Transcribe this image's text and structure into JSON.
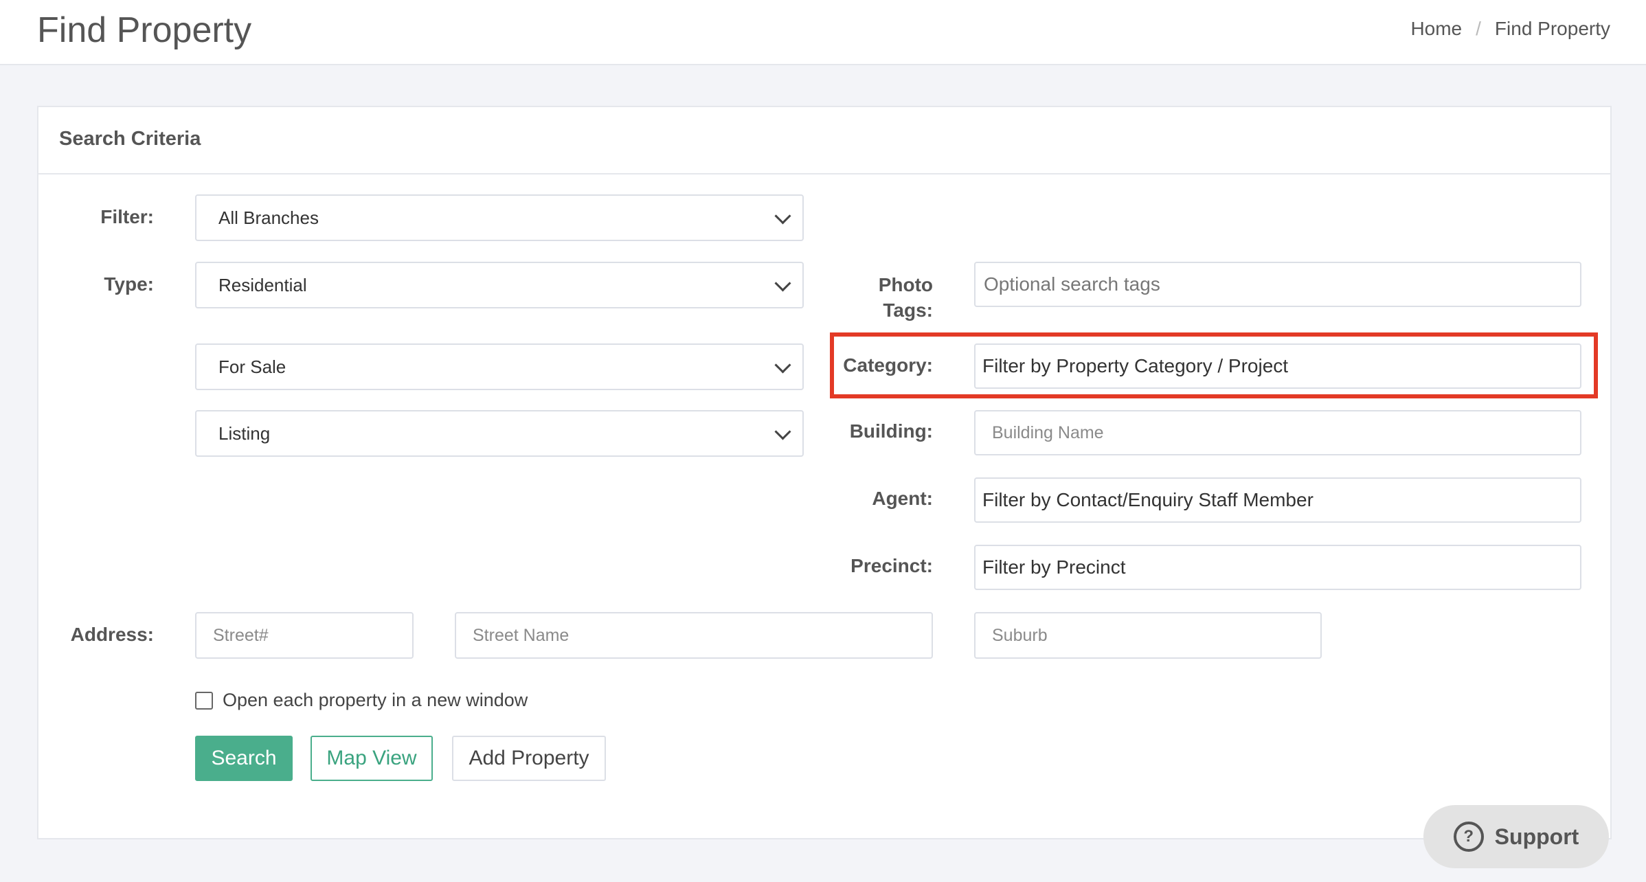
{
  "header": {
    "title": "Find Property",
    "breadcrumb": [
      "Home",
      "Find Property"
    ],
    "breadcrumb_separator": "/"
  },
  "card": {
    "title": "Search Criteria"
  },
  "labels": {
    "filter": "Filter:",
    "type": "Type:",
    "photo_tags_line1": "Photo",
    "photo_tags_line2": "Tags:",
    "category": "Category:",
    "building": "Building:",
    "agent": "Agent:",
    "precinct": "Precinct:",
    "address": "Address:"
  },
  "selects": {
    "filter": "All Branches",
    "type": "Residential",
    "sale_type": "For Sale",
    "status": "Listing"
  },
  "inputs": {
    "photo_tags_placeholder": "Optional search tags",
    "category_value": "Filter by Property Category / Project",
    "building_placeholder": "Building Name",
    "agent_value": "Filter by Contact/Enquiry Staff Member",
    "precinct_value": "Filter by Precinct",
    "street_no_placeholder": "Street#",
    "street_name_placeholder": "Street Name",
    "suburb_placeholder": "Suburb"
  },
  "options": {
    "new_window_label": "Open each property in a new window"
  },
  "buttons": {
    "search": "Search",
    "map_view": "Map View",
    "add_property": "Add Property"
  },
  "support": {
    "label": "Support",
    "icon": "question-circle-icon"
  },
  "colors": {
    "accent": "#4aae8c",
    "highlight": "#e33a26"
  }
}
